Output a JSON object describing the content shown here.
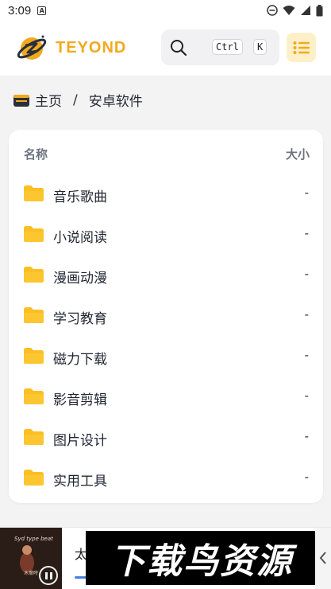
{
  "status": {
    "time": "3:09",
    "app_badge": "A"
  },
  "brand": {
    "name": "TEYOND"
  },
  "search": {
    "ctrl_key": "Ctrl",
    "k_key": "K"
  },
  "breadcrumb": {
    "home": "主页",
    "separator": "/",
    "current": "安卓软件"
  },
  "table": {
    "col_name": "名称",
    "col_size": "大小",
    "rows": [
      {
        "name": "音乐歌曲",
        "size": "-"
      },
      {
        "name": "小说阅读",
        "size": "-"
      },
      {
        "name": "漫画动漫",
        "size": "-"
      },
      {
        "name": "学习教育",
        "size": "-"
      },
      {
        "name": "磁力下载",
        "size": "-"
      },
      {
        "name": "影音剪辑",
        "size": "-"
      },
      {
        "name": "图片设计",
        "size": "-"
      },
      {
        "name": "实用工具",
        "size": "-"
      }
    ]
  },
  "player": {
    "thumb_title": "Syd type beat",
    "thumb_caption": "木葉時",
    "tab_label": "太"
  },
  "watermark": {
    "text": "下载鸟资源"
  },
  "colors": {
    "accent": "#f2a91e",
    "folder": "#fbbf24",
    "menu_bg": "#fdf0c8",
    "tab_indicator": "#4a7de0"
  },
  "icons": {
    "brand": "planet-logo-icon",
    "search": "search-icon",
    "menu": "list-menu-icon",
    "home": "home-icon",
    "folder": "folder-icon",
    "pause": "pause-icon",
    "chevron": "chevron-left-icon"
  }
}
